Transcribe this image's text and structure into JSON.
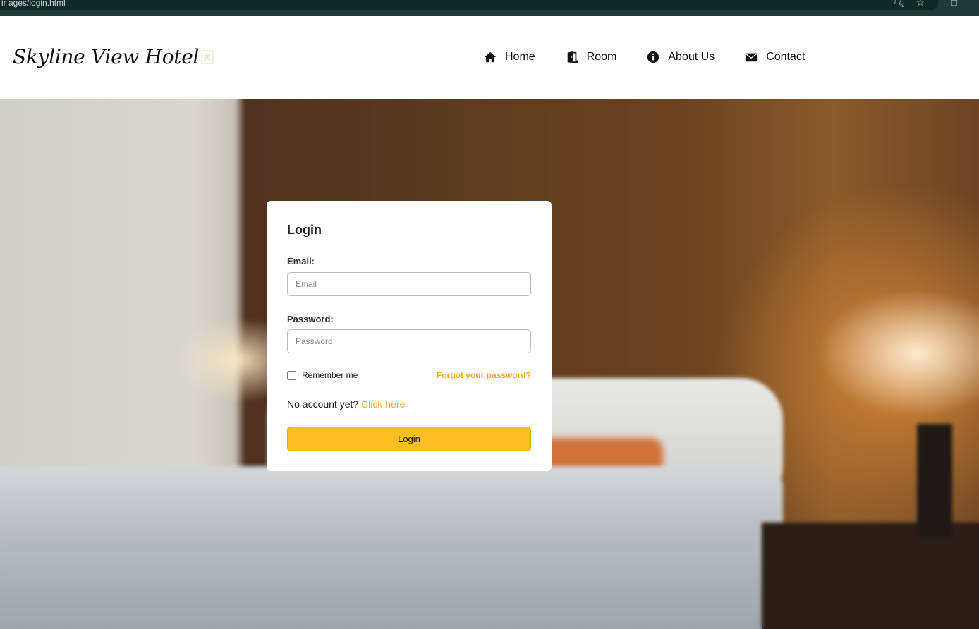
{
  "browser": {
    "url_fragment": "ir ages/login.html"
  },
  "header": {
    "brand": "Skyline View Hotel",
    "nav": [
      {
        "label": "Home",
        "icon": "home-icon"
      },
      {
        "label": "Room",
        "icon": "door-icon"
      },
      {
        "label": "About Us",
        "icon": "info-icon"
      },
      {
        "label": "Contact",
        "icon": "envelope-icon"
      }
    ]
  },
  "login": {
    "title": "Login",
    "email_label": "Email:",
    "email_placeholder": "Email",
    "password_label": "Password:",
    "password_placeholder": "Password",
    "remember_label": "Remember me",
    "forgot_label": "Forgot your password?",
    "no_account_text": "No account yet?",
    "click_here": "Click here",
    "button_label": "Login"
  },
  "colors": {
    "accent": "#fbbf24",
    "link": "#f5a623",
    "chrome": "#1d3a37"
  }
}
